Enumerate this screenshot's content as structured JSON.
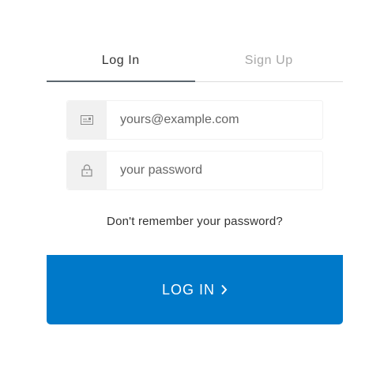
{
  "tabs": [
    {
      "label": "Log In",
      "active": true
    },
    {
      "label": "Sign Up",
      "active": false
    }
  ],
  "email": {
    "placeholder": "yours@example.com",
    "icon": "email-card-icon"
  },
  "password": {
    "placeholder": "your password",
    "icon": "lock-icon"
  },
  "forgot_link": "Don't remember your password?",
  "submit": {
    "label": "LOG IN",
    "icon": "chevron-right-icon"
  },
  "colors": {
    "accent": "#0079c9",
    "field_icon_bg": "#f1f1f1",
    "tab_active_border": "#5c666f",
    "tab_inactive_text": "#a7a7a7"
  }
}
